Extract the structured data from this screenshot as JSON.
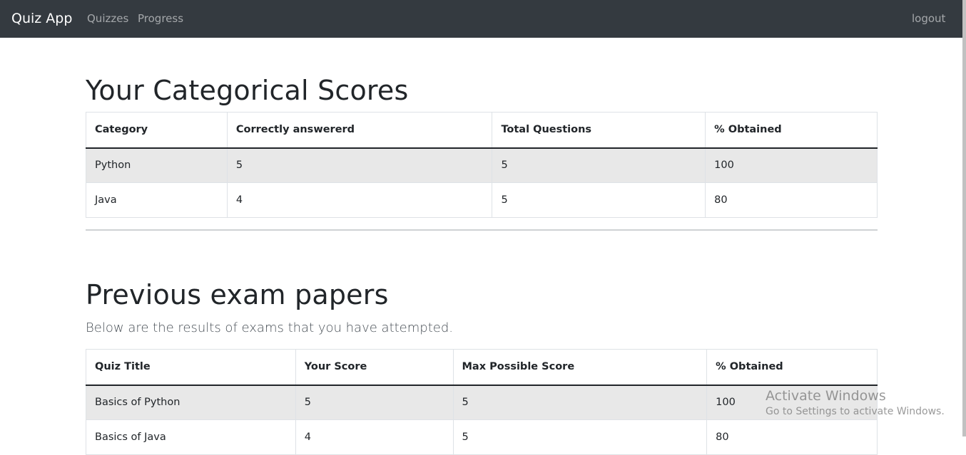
{
  "navbar": {
    "brand": "Quiz App",
    "links": [
      "Quizzes",
      "Progress"
    ],
    "logout": "logout"
  },
  "categorical": {
    "title": "Your Categorical Scores",
    "headers": [
      "Category",
      "Correctly answererd",
      "Total Questions",
      "% Obtained"
    ],
    "rows": [
      [
        "Python",
        "5",
        "5",
        "100"
      ],
      [
        "Java",
        "4",
        "5",
        "80"
      ]
    ]
  },
  "previous": {
    "title": "Previous exam papers",
    "subtitle": "Below are the results of exams that you have attempted.",
    "headers": [
      "Quiz Title",
      "Your Score",
      "Max Possible Score",
      "% Obtained"
    ],
    "rows": [
      [
        "Basics of Python",
        "5",
        "5",
        "100"
      ],
      [
        "Basics of Java",
        "4",
        "5",
        "80"
      ]
    ]
  },
  "watermark": {
    "line1": "Activate Windows",
    "line2": "Go to Settings to activate Windows."
  }
}
